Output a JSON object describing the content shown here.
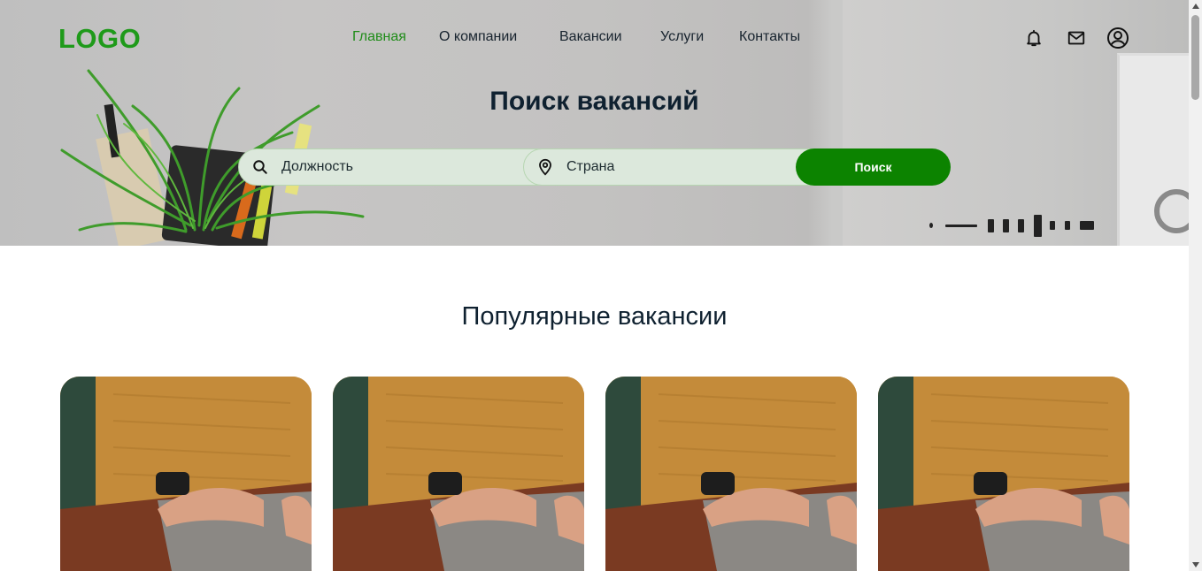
{
  "header": {
    "logo": "LOGO",
    "nav": [
      {
        "label": "Главная",
        "active": true
      },
      {
        "label": "О компании",
        "active": false
      },
      {
        "label": "Вакансии",
        "active": false
      },
      {
        "label": "Услуги",
        "active": false
      },
      {
        "label": "Контакты",
        "active": false
      }
    ],
    "icons": [
      "bell-icon",
      "mail-icon",
      "user-icon"
    ]
  },
  "hero": {
    "title": "Поиск вакансий",
    "search": {
      "role_placeholder": "Должность",
      "country_placeholder": "Страна",
      "button_label": "Поиск"
    }
  },
  "popular": {
    "title": "Популярные вакансии",
    "cards_count": 4
  },
  "colors": {
    "brand_green": "#1f9a1a",
    "button_green": "#0c8300",
    "text_dark": "#0f2130",
    "search_field_bg": "#dce8dc"
  }
}
